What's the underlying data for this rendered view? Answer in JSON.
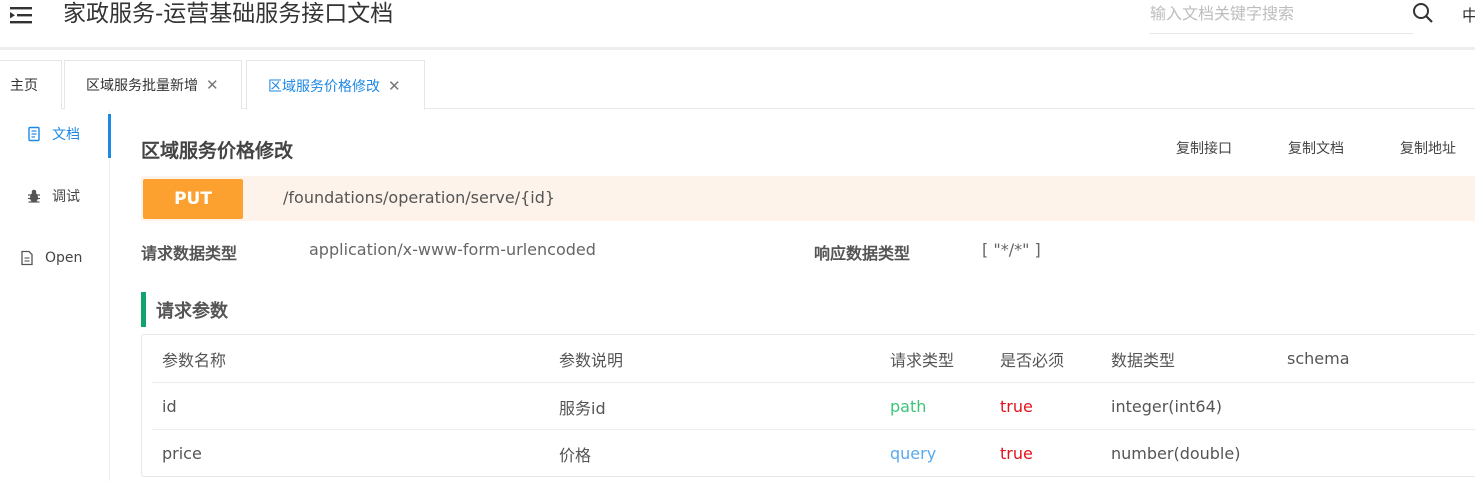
{
  "header": {
    "title": "家政服务-运营基础服务接口文档",
    "search_placeholder": "输入文档关键字搜索",
    "lang_label": "中"
  },
  "tabs": [
    {
      "label": "主页",
      "closable": false,
      "active": false
    },
    {
      "label": "区域服务批量新增",
      "closable": true,
      "active": false
    },
    {
      "label": "区域服务价格修改",
      "closable": true,
      "active": true
    }
  ],
  "close_glyph": "✕",
  "leftnav": {
    "items": [
      {
        "label": "文档",
        "icon": "document-icon",
        "active": true
      },
      {
        "label": "调试",
        "icon": "bug-icon",
        "active": false
      },
      {
        "label": "Open",
        "icon": "file-icon",
        "active": false
      }
    ]
  },
  "content": {
    "title": "区域服务价格修改",
    "copy_buttons": [
      "复制接口",
      "复制文档",
      "复制地址"
    ],
    "method": "PUT",
    "path": "/foundations/operation/serve/{id}",
    "request_type_label": "请求数据类型",
    "request_type_value": "application/x-www-form-urlencoded",
    "response_type_label": "响应数据类型",
    "response_type_value": "[ \"*/*\" ]",
    "params_section_title": "请求参数"
  },
  "params_table": {
    "headers": [
      "参数名称",
      "参数说明",
      "请求类型",
      "是否必须",
      "数据类型",
      "schema"
    ],
    "rows": [
      {
        "name": "id",
        "desc": "服务id",
        "in": "path",
        "required": "true",
        "type": "integer(int64)",
        "schema": ""
      },
      {
        "name": "price",
        "desc": "价格",
        "in": "query",
        "required": "true",
        "type": "number(double)",
        "schema": ""
      }
    ]
  },
  "colors": {
    "accent": "#1e88e5",
    "put_badge": "#fca130",
    "method_bar_bg": "#fdf3ea",
    "section_bar": "#12a26c",
    "in_path": "#3ec47a",
    "in_query": "#5aa9ee",
    "required_true": "#e4121b"
  }
}
